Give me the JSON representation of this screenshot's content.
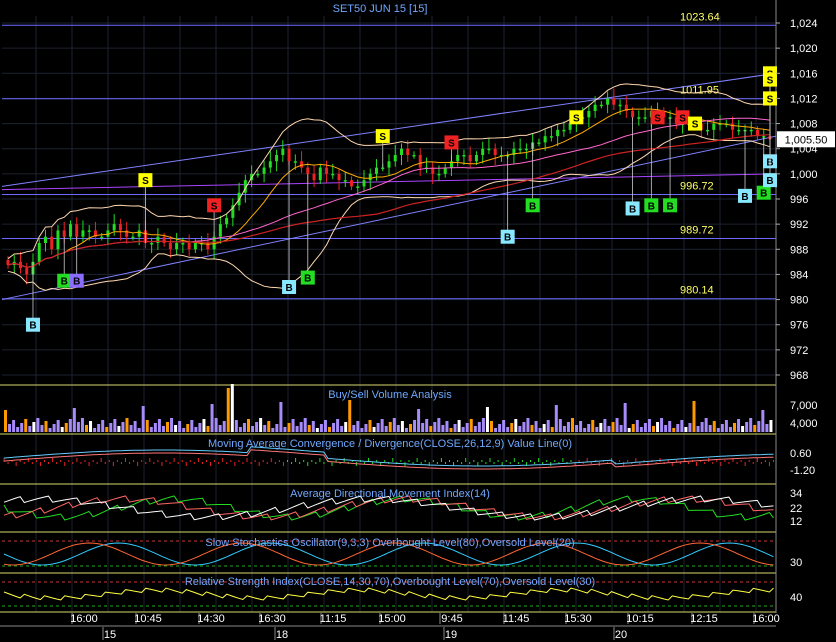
{
  "chart_data": {
    "type": "line",
    "title": "SET50 JUN 15   [15]",
    "colors": {
      "background": "#000000",
      "grid": "#1c2230",
      "panel_border": "#d8d870",
      "level_line": "#6a6aff",
      "level_label": "#ffff66",
      "axis_text": "#ffffff",
      "title_text": "#6fa8ff",
      "candle_up": "#22dd22",
      "candle_down": "#ee2222",
      "sell_signal": "#ffff00",
      "buy_signal_green": "#22dd22",
      "buy_signal_cyan": "#88e8ff",
      "bollinger": "#ffd8b0",
      "channel": "#8080ff"
    },
    "price_panel": {
      "ylim": [
        970,
        1026
      ],
      "yticks": [
        "1,024",
        "1,020",
        "1,016",
        "1,012",
        "1,008",
        "1,004",
        "1,000",
        "996",
        "992",
        "988",
        "984",
        "980",
        "976",
        "972",
        "968"
      ],
      "last_price": "1,005.50",
      "levels": [
        {
          "value": 1023.64,
          "label": "1023.64"
        },
        {
          "value": 1011.95,
          "label": "1011.95"
        },
        {
          "value": 996.72,
          "label": "996.72"
        },
        {
          "value": 989.72,
          "label": "989.72"
        },
        {
          "value": 980.14,
          "label": "980.14"
        }
      ],
      "close": [
        985.5,
        986,
        985,
        984,
        986,
        989,
        990,
        988,
        991,
        990,
        992,
        990,
        991,
        991,
        990,
        990,
        991,
        992,
        991,
        990,
        990,
        991,
        989,
        989,
        990,
        989,
        988,
        989,
        989,
        988,
        989,
        989,
        988,
        990,
        992,
        993,
        995,
        997,
        999,
        1000,
        1000,
        1001,
        1002,
        1003,
        1004,
        1002,
        1002,
        1001,
        1000,
        999,
        1001,
        1000,
        1000,
        999,
        999,
        998,
        998,
        999,
        1000,
        1001,
        1001,
        1002,
        1003,
        1004,
        1003,
        1003,
        1001,
        1001,
        1000,
        1000,
        1001,
        1002,
        1003,
        1003,
        1002,
        1003,
        1004,
        1004,
        1003,
        1003,
        1003,
        1004,
        1004,
        1004,
        1005,
        1005,
        1006,
        1006,
        1007,
        1007,
        1008,
        1009,
        1009,
        1010,
        1011,
        1011,
        1012,
        1011,
        1011,
        1010,
        1009,
        1009,
        1009,
        1010,
        1010,
        1009,
        1009,
        1008,
        1008,
        1008,
        1008,
        1007,
        1007,
        1008,
        1008,
        1008,
        1007,
        1007,
        1007,
        1007,
        1006,
        1006,
        1005.5
      ],
      "signals": [
        {
          "type": "B",
          "color": "cyan",
          "bar": 4,
          "price": 976
        },
        {
          "type": "B",
          "color": "green",
          "bar": 9,
          "price": 983
        },
        {
          "type": "B",
          "color": "purple",
          "bar": 11,
          "price": 983
        },
        {
          "type": "S",
          "color": "yellow",
          "bar": 22,
          "price": 999
        },
        {
          "type": "S",
          "color": "red",
          "bar": 33,
          "price": 995
        },
        {
          "type": "B",
          "color": "cyan",
          "bar": 45,
          "price": 982
        },
        {
          "type": "B",
          "color": "green",
          "bar": 48,
          "price": 983.5
        },
        {
          "type": "S",
          "color": "yellow",
          "bar": 60,
          "price": 1006
        },
        {
          "type": "S",
          "color": "red",
          "bar": 71,
          "price": 1005
        },
        {
          "type": "B",
          "color": "cyan",
          "bar": 80,
          "price": 990
        },
        {
          "type": "B",
          "color": "green",
          "bar": 84,
          "price": 995
        },
        {
          "type": "S",
          "color": "yellow",
          "bar": 91,
          "price": 1009
        },
        {
          "type": "B",
          "color": "cyan",
          "bar": 100,
          "price": 994.5
        },
        {
          "type": "B",
          "color": "green",
          "bar": 103,
          "price": 995
        },
        {
          "type": "B",
          "color": "green",
          "bar": 106,
          "price": 995
        },
        {
          "type": "S",
          "color": "red",
          "bar": 104,
          "price": 1009
        },
        {
          "type": "S",
          "color": "red",
          "bar": 108,
          "price": 1009
        },
        {
          "type": "S",
          "color": "yellow",
          "bar": 110,
          "price": 1008
        },
        {
          "type": "B",
          "color": "cyan",
          "bar": 118,
          "price": 996.5
        },
        {
          "type": "B",
          "color": "green",
          "bar": 121,
          "price": 997
        },
        {
          "type": "S",
          "color": "yellow",
          "bar": 136,
          "price": 1016
        },
        {
          "type": "S",
          "color": "red",
          "bar": 145,
          "price": 1015
        },
        {
          "type": "S",
          "color": "yellow",
          "bar": 154,
          "price": 1015
        },
        {
          "type": "B",
          "color": "cyan",
          "bar": 152,
          "price": 1002
        },
        {
          "type": "S",
          "color": "pink",
          "bar": 158,
          "price": 1012
        },
        {
          "type": "B",
          "color": "cyan",
          "bar": 164,
          "price": 999
        },
        {
          "type": "S",
          "color": "yellow",
          "bar": 174,
          "price": 1012
        }
      ]
    },
    "volume_panel": {
      "title": "Buy/Sell Volume Analysis",
      "yticks": [
        "7,000",
        "4,000"
      ]
    },
    "macd_panel": {
      "title": "Moving Average Convergence / Divergence(CLOSE,26,12,9) Value Line(0)",
      "yticks": [
        "0.60",
        "-1.20"
      ]
    },
    "adx_panel": {
      "title": "Average Directional Movement Index(14)",
      "yticks": [
        "34",
        "22",
        "12"
      ]
    },
    "stoch_panel": {
      "title": "Slow Stochastics Oscillator(9,3,3) Overbought Level(80),Oversold Level(20)",
      "yticks": [
        "30"
      ]
    },
    "rsi_panel": {
      "title": "Relative Strength Index(CLOSE,14,30,70),Overbought Level(70),Oversold Level(30)",
      "yticks": [
        "40"
      ]
    },
    "x_axis": {
      "time_labels": [
        "16:00",
        "10:45",
        "14:30",
        "16:30",
        "11:15",
        "15:00",
        "9:45",
        "11:45",
        "15:30",
        "10:15",
        "12:15",
        "16:00"
      ],
      "date_labels": [
        "15",
        "18",
        "19",
        "20"
      ]
    }
  }
}
